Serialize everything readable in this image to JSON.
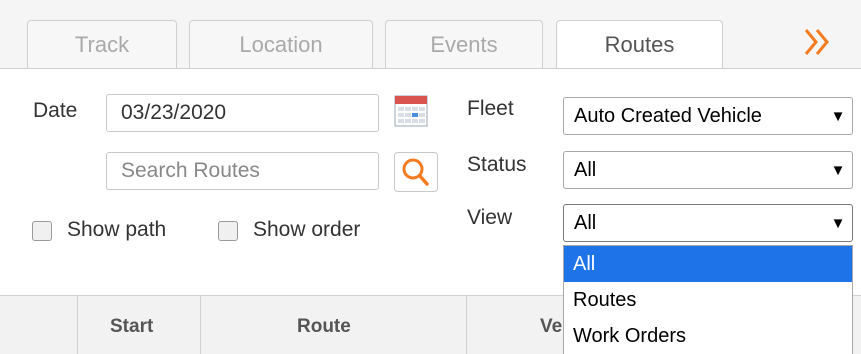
{
  "tabs": [
    {
      "label": "Track",
      "active": false
    },
    {
      "label": "Location",
      "active": false
    },
    {
      "label": "Events",
      "active": false
    },
    {
      "label": "Routes",
      "active": true
    }
  ],
  "icons": {
    "more": "double-chevron-right-icon",
    "calendar": "calendar-icon",
    "search": "search-icon"
  },
  "colors": {
    "accent_orange": "#f47b20",
    "selected_option": "#1e73e8"
  },
  "date": {
    "label": "Date",
    "value": "03/23/2020"
  },
  "search": {
    "placeholder": "Search Routes"
  },
  "options": {
    "show_path": "Show path",
    "show_order": "Show order"
  },
  "fleet": {
    "label": "Fleet",
    "value": "Auto Created Vehicle"
  },
  "status": {
    "label": "Status",
    "value": "All"
  },
  "view": {
    "label": "View",
    "value": "All",
    "options": [
      "All",
      "Routes",
      "Work Orders"
    ]
  },
  "grid": {
    "columns": [
      "",
      "Start",
      "Route",
      "Ve"
    ]
  }
}
